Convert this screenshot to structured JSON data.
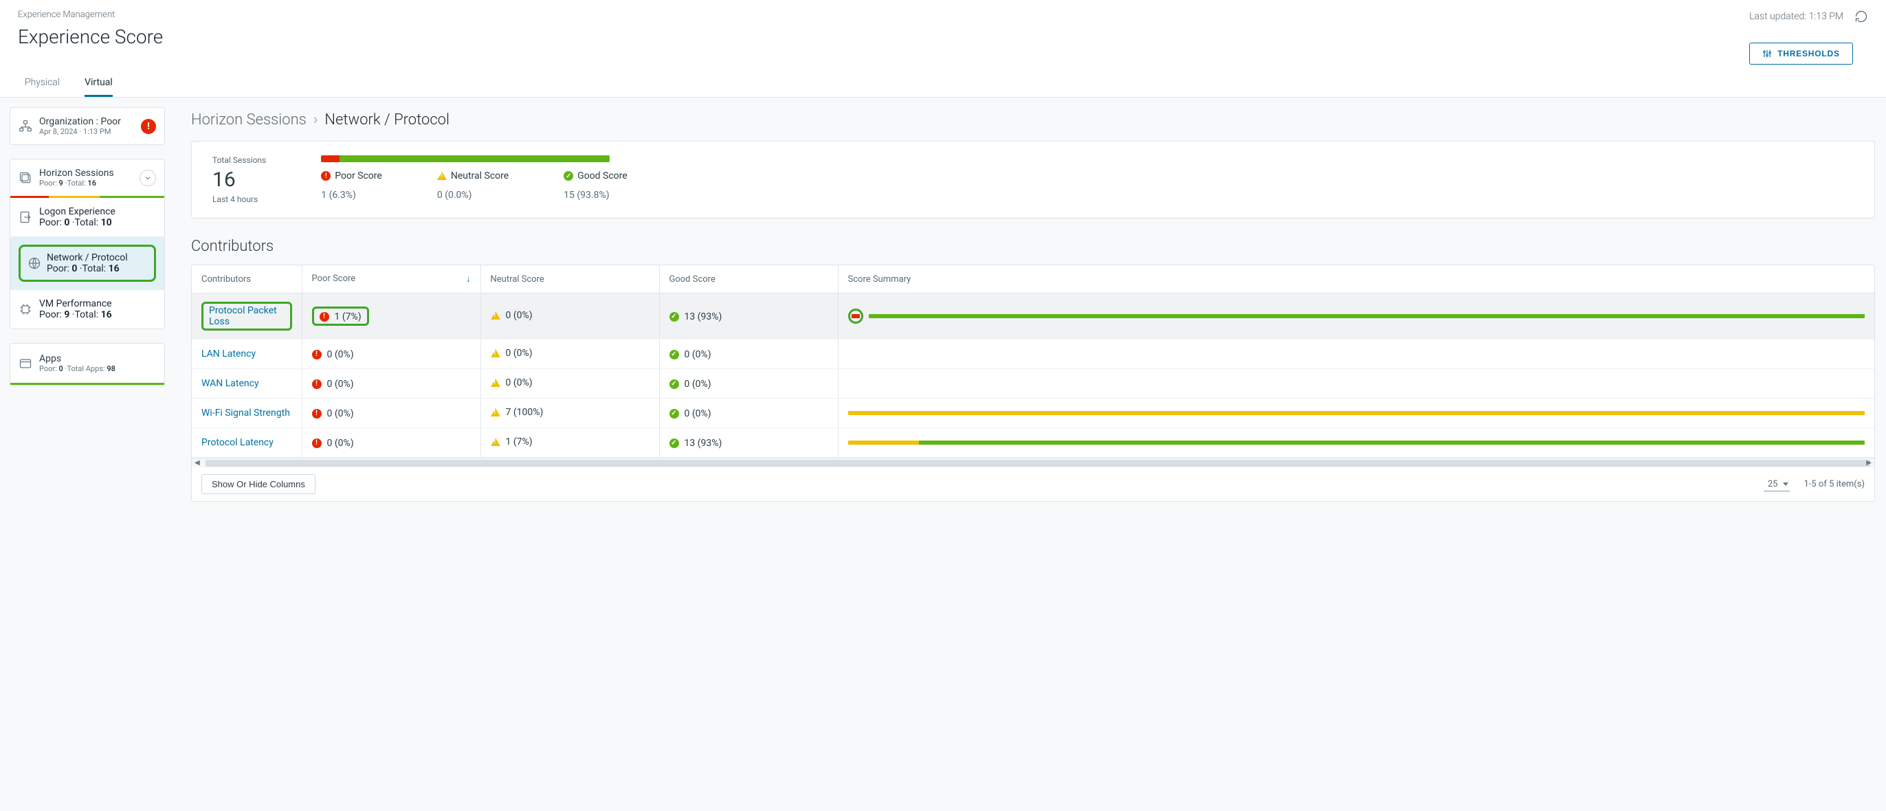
{
  "header": {
    "breadcrumb": "Experience Management",
    "title": "Experience Score",
    "last_updated": "Last updated: 1:13 PM",
    "thresholds_btn": "THRESHOLDS"
  },
  "tabs": {
    "physical": "Physical",
    "virtual": "Virtual"
  },
  "sidebar": {
    "org": {
      "title": "Organization : Poor",
      "sub": "Apr 8, 2024 · 1:13 PM"
    },
    "sessions": {
      "title": "Horizon Sessions",
      "sub_pre": "Poor: ",
      "sub_poor": "9",
      "sub_mid": " ·Total: ",
      "sub_total": "16",
      "bar": {
        "red": 25,
        "yellow": 33,
        "green": 42
      }
    },
    "logon": {
      "title": "Logon Experience",
      "sub": "Poor: 0 ·Total: 10"
    },
    "network": {
      "title": "Network / Protocol",
      "sub_pre": "Poor: ",
      "sub_poor": "0",
      "sub_mid": " ·Total: ",
      "sub_total": "16"
    },
    "vm": {
      "title": "VM Performance",
      "sub_pre": "Poor: ",
      "sub_poor": "9",
      "sub_mid": " ·Total: ",
      "sub_total": "16"
    },
    "apps": {
      "title": "Apps",
      "sub_pre": "Poor: ",
      "sub_poor": "0",
      "sub_mid": " ·Total Apps: ",
      "sub_total": "98"
    }
  },
  "main": {
    "bc1": "Horizon Sessions",
    "bc2": "Network / Protocol",
    "summary": {
      "label": "Total Sessions",
      "big": "16",
      "window": "Last 4 hours",
      "bar": {
        "red": 6.3,
        "yellow": 0,
        "green": 93.7
      },
      "poor_h": "Poor Score",
      "poor_v": "1 (6.3%)",
      "neutral_h": "Neutral Score",
      "neutral_v": "0 (0.0%)",
      "good_h": "Good Score",
      "good_v": "15 (93.8%)"
    },
    "contrib_title": "Contributors",
    "table": {
      "headers": {
        "c": "Contributors",
        "p": "Poor Score",
        "n": "Neutral Score",
        "g": "Good Score",
        "s": "Score Summary"
      },
      "rows": [
        {
          "name": "Protocol Packet Loss",
          "poor": "1 (7%)",
          "neutral": "0 (0%)",
          "good": "13 (93%)",
          "bar": {
            "red": 7,
            "yellow": 0,
            "green": 93
          },
          "hl": true
        },
        {
          "name": "LAN Latency",
          "poor": "0 (0%)",
          "neutral": "0 (0%)",
          "good": "0 (0%)",
          "bar": null
        },
        {
          "name": "WAN Latency",
          "poor": "0 (0%)",
          "neutral": "0 (0%)",
          "good": "0 (0%)",
          "bar": null
        },
        {
          "name": "Wi-Fi Signal Strength",
          "poor": "0 (0%)",
          "neutral": "7 (100%)",
          "good": "0 (0%)",
          "bar": {
            "red": 0,
            "yellow": 100,
            "green": 0
          }
        },
        {
          "name": "Protocol Latency",
          "poor": "0 (0%)",
          "neutral": "1 (7%)",
          "good": "13 (93%)",
          "bar": {
            "red": 0,
            "yellow": 7,
            "green": 93
          }
        }
      ],
      "show_hide": "Show Or Hide Columns",
      "page_size": "25",
      "pager_text": "1-5 of 5 item(s)"
    }
  }
}
